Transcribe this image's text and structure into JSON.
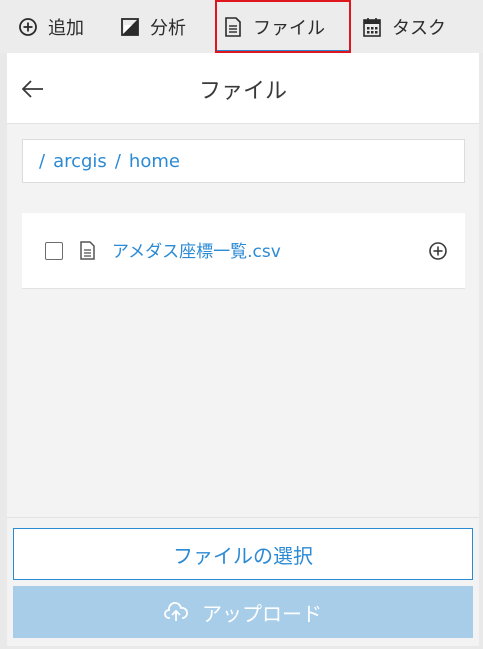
{
  "tabs": {
    "add": "追加",
    "analysis": "分析",
    "file": "ファイル",
    "task": "タスク"
  },
  "panel": {
    "title": "ファイル",
    "breadcrumb": [
      "/",
      "arcgis",
      "/",
      "home"
    ],
    "files": [
      {
        "name": "アメダス座標一覧.csv"
      }
    ]
  },
  "footer": {
    "select_label": "ファイルの選択",
    "upload_label": "アップロード"
  },
  "colors": {
    "accent": "#2b8ad4",
    "highlight": "#e0161e",
    "disabled_button": "#a8cde9"
  }
}
